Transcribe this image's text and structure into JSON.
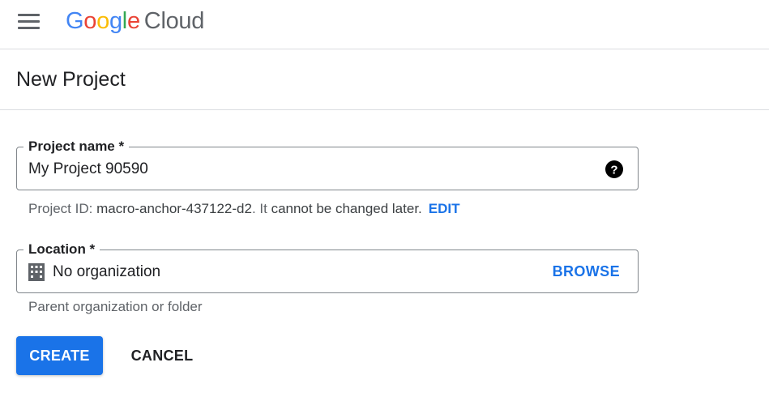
{
  "header": {
    "logo_letters": [
      "G",
      "o",
      "o",
      "g",
      "l",
      "e"
    ],
    "logo_colors": [
      "#4285F4",
      "#EA4335",
      "#FBBC05",
      "#4285F4",
      "#34A853",
      "#EA4335"
    ],
    "logo_suffix": "Cloud",
    "menu_icon": "hamburger-menu-icon"
  },
  "page": {
    "title": "New Project"
  },
  "project_name": {
    "label": "Project name *",
    "value": "My Project 90590",
    "help_icon": "help-circle-icon"
  },
  "project_id": {
    "prefix": "Project ID: ",
    "id": "macro-anchor-437122-d2",
    "middle": ". It ",
    "emphasis": "cannot be changed later.",
    "edit_label": "EDIT"
  },
  "location": {
    "label": "Location *",
    "value": "No organization",
    "icon": "building-icon",
    "browse_label": "BROWSE",
    "hint": "Parent organization or folder"
  },
  "actions": {
    "create_label": "CREATE",
    "cancel_label": "CANCEL"
  },
  "colors": {
    "accent": "#1a73e8",
    "border": "#80868b",
    "divider": "#dadce0"
  }
}
